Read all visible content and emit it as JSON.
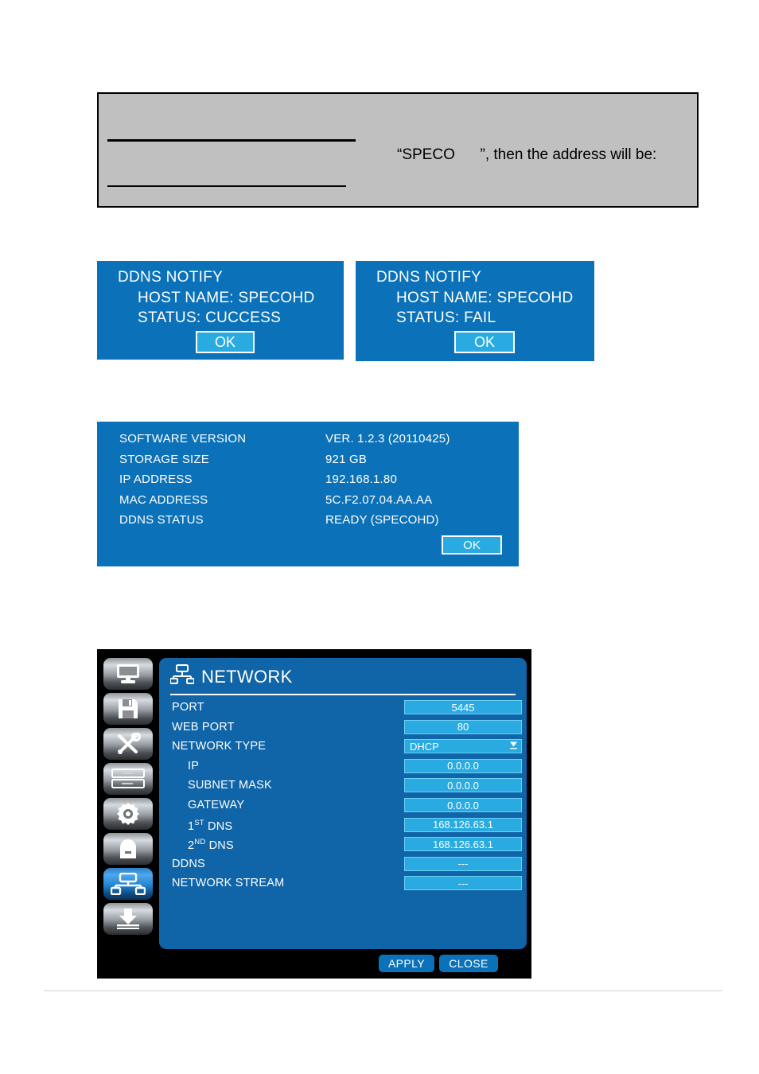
{
  "note_box": {
    "text": "“SPECO      ”, then the address will be:"
  },
  "ddns_notify_success": {
    "title": "DDNS NOTIFY",
    "host_name": "HOST NAME: SPECOHD",
    "status": "STATUS: CUCCESS",
    "ok_label": "OK"
  },
  "ddns_notify_fail": {
    "title": "DDNS NOTIFY",
    "host_name": "HOST NAME: SPECOHD",
    "status": "STATUS: FAIL",
    "ok_label": "OK"
  },
  "system_info": {
    "rows": [
      {
        "label": "SOFTWARE VERSION",
        "value": "VER. 1.2.3 (20110425)"
      },
      {
        "label": "STORAGE SIZE",
        "value": "921 GB"
      },
      {
        "label": "IP ADDRESS",
        "value": "192.168.1.80"
      },
      {
        "label": "MAC ADDRESS",
        "value": "5C.F2.07.04.AA.AA"
      },
      {
        "label": "DDNS STATUS",
        "value": "READY (SPECOHD)"
      }
    ],
    "ok_label": "OK"
  },
  "network_dialog": {
    "title": "NETWORK",
    "sidebar": [
      {
        "name": "display-icon",
        "active": false
      },
      {
        "name": "record-save-icon",
        "active": false
      },
      {
        "name": "tools-icon",
        "active": false
      },
      {
        "name": "device-list-icon",
        "active": false
      },
      {
        "name": "system-gear-icon",
        "active": false
      },
      {
        "name": "security-lock-icon",
        "active": false
      },
      {
        "name": "network-icon",
        "active": true
      },
      {
        "name": "backup-download-icon",
        "active": false
      }
    ],
    "rows": [
      {
        "label": "PORT",
        "indent": 0,
        "value": "5445",
        "type": "text"
      },
      {
        "label": "WEB PORT",
        "indent": 0,
        "value": "80",
        "type": "text"
      },
      {
        "label": "NETWORK TYPE",
        "indent": 0,
        "value": "DHCP",
        "type": "select"
      },
      {
        "label": "IP",
        "indent": 1,
        "value": "0.0.0.0",
        "type": "text"
      },
      {
        "label": "SUBNET MASK",
        "indent": 1,
        "value": "0.0.0.0",
        "type": "text"
      },
      {
        "label": "GATEWAY",
        "indent": 1,
        "value": "0.0.0.0",
        "type": "text"
      },
      {
        "label": "1ST DNS",
        "indent": 1,
        "value": "168.126.63.1",
        "type": "text",
        "sup": "ST",
        "base": "1"
      },
      {
        "label": "2ND DNS",
        "indent": 1,
        "value": "168.126.63.1",
        "type": "text",
        "sup": "ND",
        "base": "2"
      },
      {
        "label": "DDNS",
        "indent": 0,
        "value": "---",
        "type": "text"
      },
      {
        "label": "NETWORK STREAM",
        "indent": 0,
        "value": "---",
        "type": "text"
      }
    ],
    "apply_label": "APPLY",
    "close_label": "CLOSE"
  },
  "colors": {
    "dialog_blue": "#0b72ba",
    "panel_blue": "#1064a8",
    "field_cyan": "#29abe2",
    "note_gray": "#c0c0c0",
    "frame_black": "#000000"
  }
}
